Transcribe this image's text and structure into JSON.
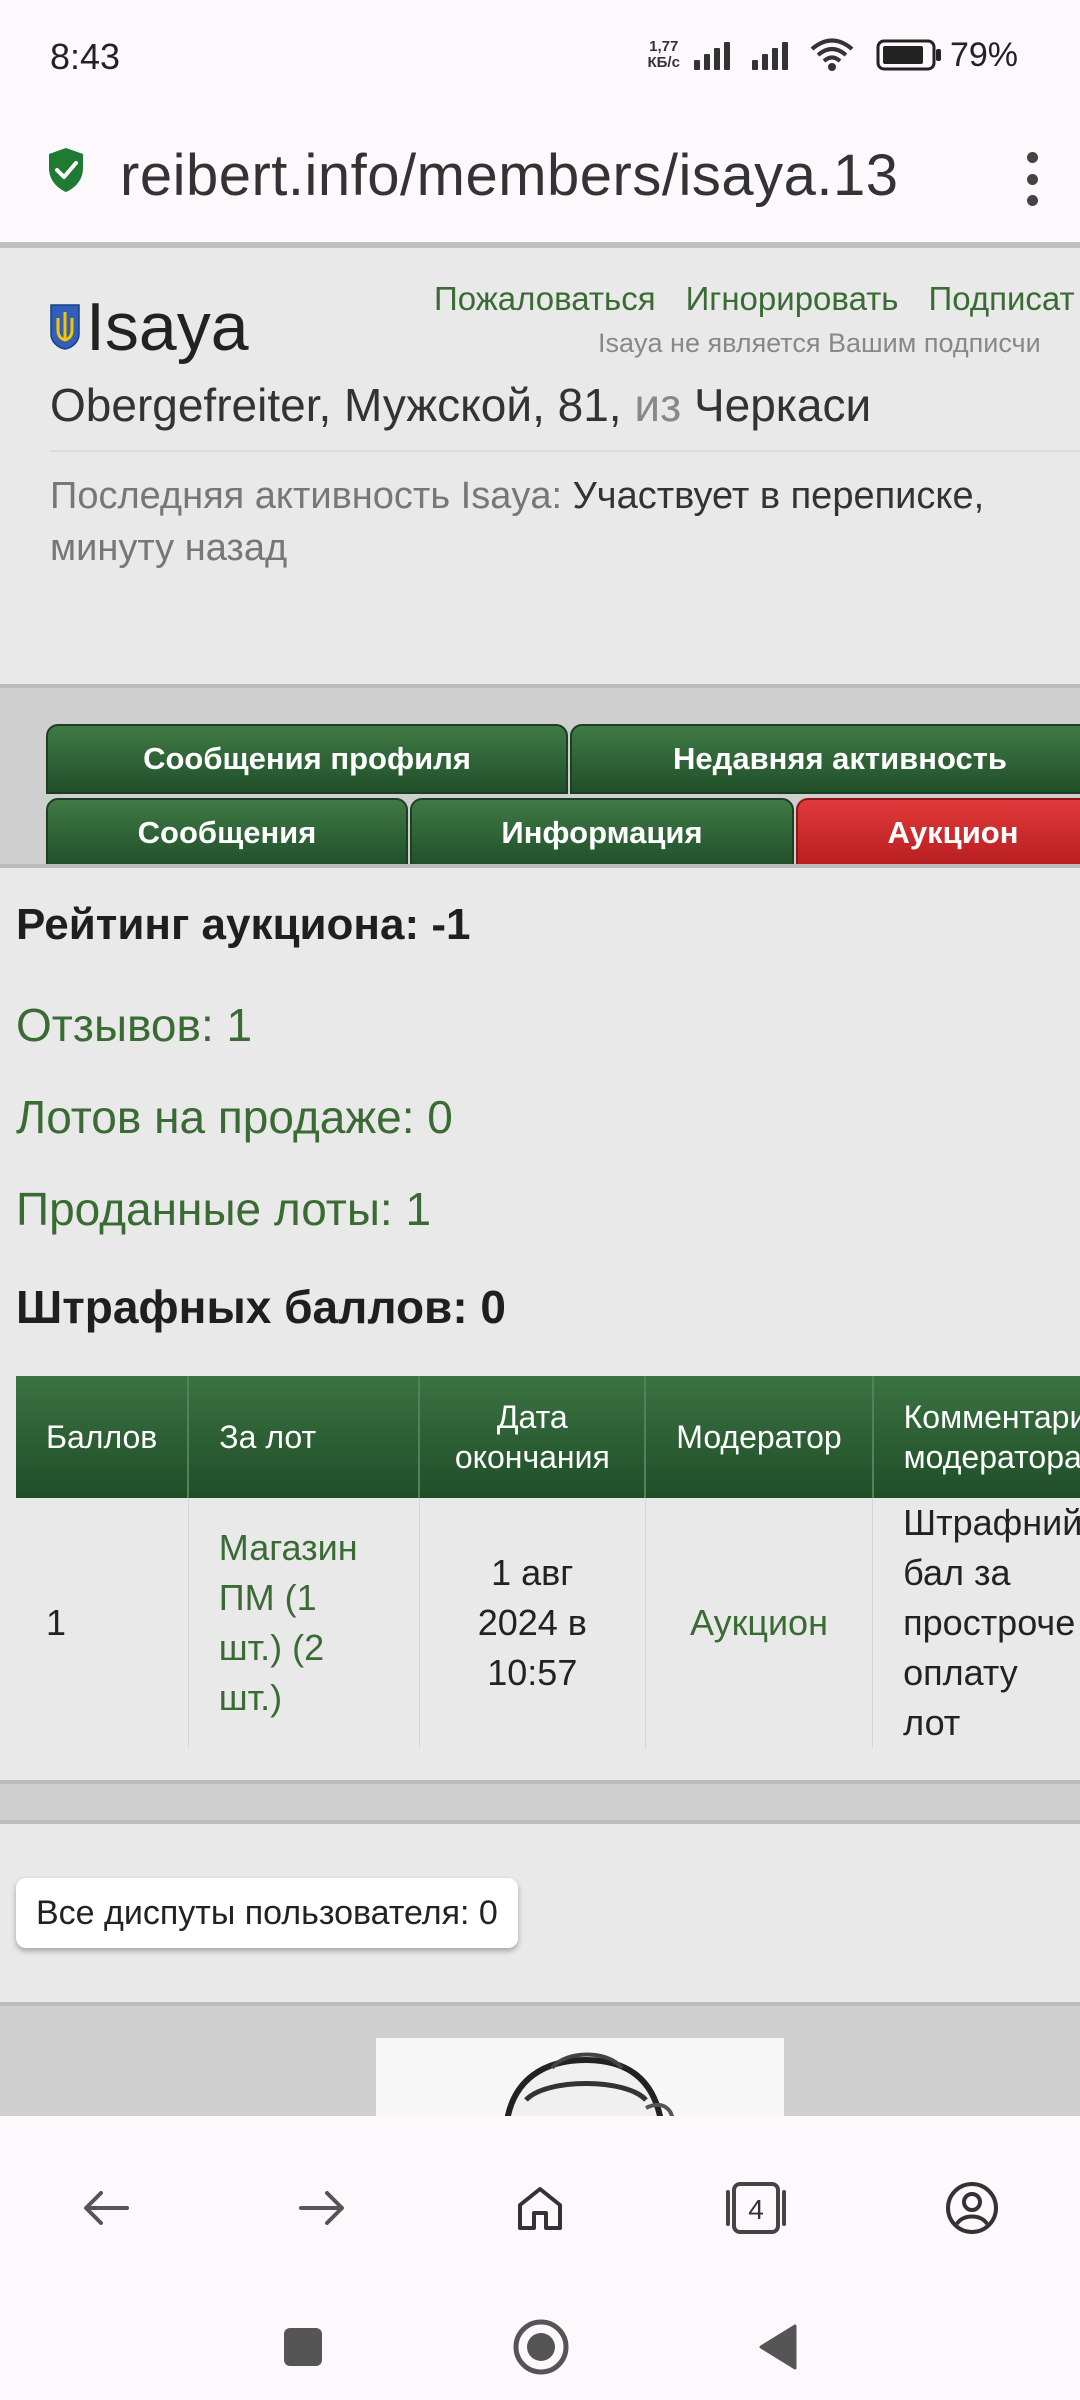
{
  "status_bar": {
    "time": "8:43",
    "net_speed_value": "1,77",
    "net_speed_unit": "КБ/с",
    "battery": "79%"
  },
  "url_bar": {
    "url": "reibert.info/members/isaya.13"
  },
  "profile": {
    "username": "Isaya",
    "actions": [
      "Пожаловаться",
      "Игнорировать",
      "Подписат"
    ],
    "subscribe_note": "Isaya не является Вашим подписчи",
    "info_main": "Obergefreiter, Мужской, 81,",
    "info_from": "из",
    "info_city": "Черкаси",
    "last_activity_label": "Последняя активность Isaya:",
    "last_activity_value": "Участвует в переписке,",
    "last_activity_time": "минуту назад"
  },
  "tabs": {
    "row1": [
      "Сообщения профиля",
      "Недавняя активность"
    ],
    "row2": [
      "Сообщения",
      "Информация",
      "Аукцион"
    ],
    "active": "Аукцион"
  },
  "auction": {
    "rating": "Рейтинг аукциона: -1",
    "reviews": "Отзывов: 1",
    "lots_for_sale": "Лотов на продаже: 0",
    "sold_lots": "Проданные лоты: 1",
    "penalty_points": "Штрафных баллов: 0"
  },
  "penalty_table": {
    "headers": [
      "Баллов",
      "За лот",
      "Дата окончания",
      "Модератор",
      "Комментари модератора"
    ],
    "rows": [
      {
        "points": "1",
        "lot": "Магазин ПМ (1 шт.) (2 шт.)",
        "date": "1 авг 2024 в 10:57",
        "moderator": "Аукцион",
        "comment": "Штрафний бал за простроче оплату лот"
      }
    ]
  },
  "disputes": {
    "label": "Все диспуты пользователя: 0"
  },
  "bottom_nav": {
    "tab_count": "4"
  }
}
